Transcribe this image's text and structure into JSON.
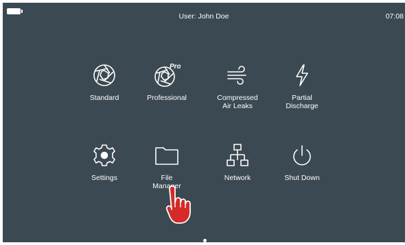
{
  "status_bar": {
    "user": "User: John Doe",
    "time": "07:08",
    "battery_icon": "battery-icon"
  },
  "apps": [
    {
      "id": "standard",
      "label": "Standard",
      "icon": "camera-aperture-icon"
    },
    {
      "id": "professional",
      "label": "Professional",
      "icon": "camera-aperture-pro-icon",
      "badge": "Pro"
    },
    {
      "id": "compressed-air-leaks",
      "label": "Compressed\nAir Leaks",
      "icon": "wind-icon"
    },
    {
      "id": "partial-discharge",
      "label": "Partial\nDischarge",
      "icon": "lightning-icon"
    },
    {
      "id": "settings",
      "label": "Settings",
      "icon": "gear-icon"
    },
    {
      "id": "file-manager",
      "label": "File\nManager",
      "icon": "folder-icon"
    },
    {
      "id": "network",
      "label": "Network",
      "icon": "network-icon"
    },
    {
      "id": "shut-down",
      "label": "Shut Down",
      "icon": "power-icon"
    }
  ],
  "pager": {
    "current": 1,
    "total": 1
  },
  "colors": {
    "background": "#3b4952",
    "foreground": "#ffffff",
    "pointer": "#d42a2a"
  },
  "pointer_icon": "hand-pointer-icon"
}
